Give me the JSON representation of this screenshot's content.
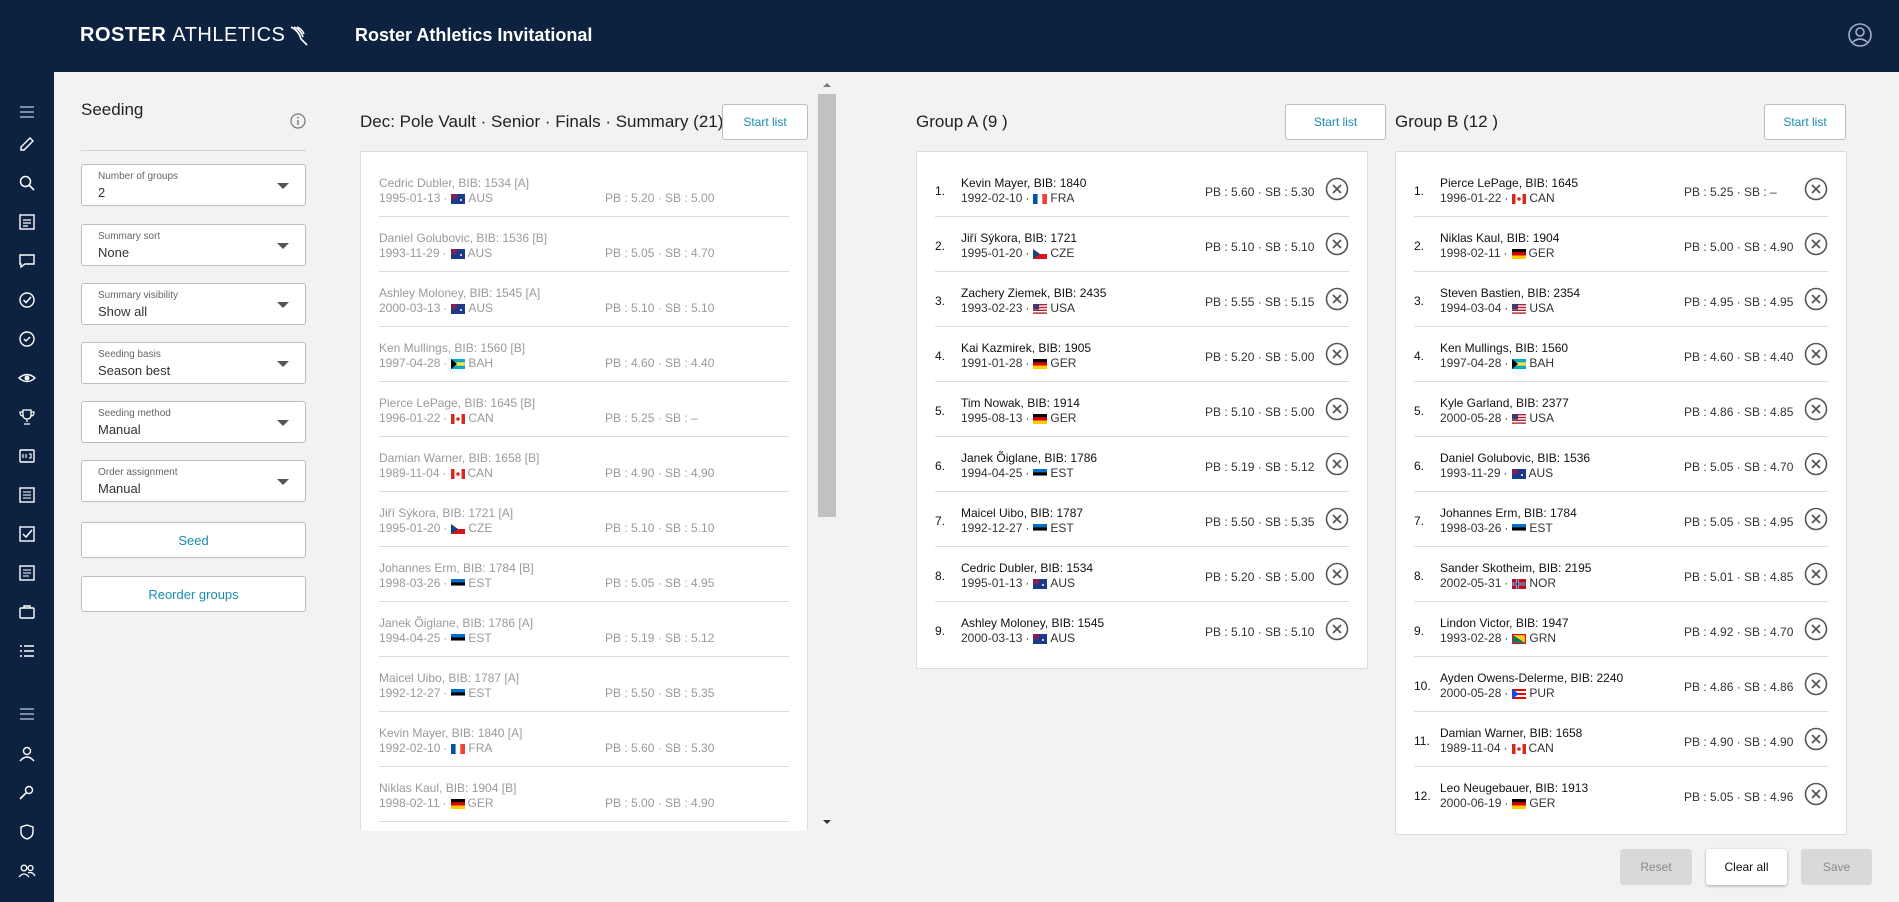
{
  "header": {
    "logo_bold": "ROSTER",
    "logo_light": "ATHLETICS",
    "app_title": "Roster Athletics Invitational"
  },
  "rail_icons": [
    "menu-icon",
    "edit-icon",
    "search-icon",
    "list-icon",
    "chat-icon",
    "check-circle-icon",
    "check-circle-outline-icon",
    "eye-icon",
    "trophy-icon",
    "scoreboard-icon",
    "document-icon",
    "checkbox-icon",
    "notes-icon",
    "briefcase-icon",
    "list-bullets-icon",
    "menu-icon",
    "person-icon",
    "pin-icon",
    "shield-icon",
    "group-icon",
    "table-icon"
  ],
  "seeding": {
    "title": "Seeding",
    "fields": [
      {
        "label": "Number of groups",
        "value": "2"
      },
      {
        "label": "Summary sort",
        "value": "None"
      },
      {
        "label": "Summary visibility",
        "value": "Show all"
      },
      {
        "label": "Seeding basis",
        "value": "Season best"
      },
      {
        "label": "Seeding method",
        "value": "Manual"
      },
      {
        "label": "Order assignment",
        "value": "Manual"
      }
    ],
    "seed_label": "Seed",
    "reorder_label": "Reorder groups"
  },
  "summary": {
    "title": "Dec: Pole Vault · Senior · Finals · Summary (21)",
    "start_list_label": "Start list",
    "rows": [
      {
        "name": "Cedric Dubler, BIB: 1534 [A]",
        "dob": "1995-01-13",
        "country": "AUS",
        "pbsb": "PB : 5.20 · SB : 5.00"
      },
      {
        "name": "Daniel Golubovic, BIB: 1536 [B]",
        "dob": "1993-11-29",
        "country": "AUS",
        "pbsb": "PB : 5.05 · SB : 4.70"
      },
      {
        "name": "Ashley Moloney, BIB: 1545 [A]",
        "dob": "2000-03-13",
        "country": "AUS",
        "pbsb": "PB : 5.10 · SB : 5.10"
      },
      {
        "name": "Ken Mullings, BIB: 1560 [B]",
        "dob": "1997-04-28",
        "country": "BAH",
        "pbsb": "PB : 4.60 · SB : 4.40"
      },
      {
        "name": "Pierce LePage, BIB: 1645 [B]",
        "dob": "1996-01-22",
        "country": "CAN",
        "pbsb": "PB : 5.25 · SB : –"
      },
      {
        "name": "Damian Warner, BIB: 1658 [B]",
        "dob": "1989-11-04",
        "country": "CAN",
        "pbsb": "PB : 4.90 · SB : 4.90"
      },
      {
        "name": "Jiří Sýkora, BIB: 1721 [A]",
        "dob": "1995-01-20",
        "country": "CZE",
        "pbsb": "PB : 5.10 · SB : 5.10"
      },
      {
        "name": "Johannes Erm, BIB: 1784 [B]",
        "dob": "1998-03-26",
        "country": "EST",
        "pbsb": "PB : 5.05 · SB : 4.95"
      },
      {
        "name": "Janek Õiglane, BIB: 1786 [A]",
        "dob": "1994-04-25",
        "country": "EST",
        "pbsb": "PB : 5.19 · SB : 5.12"
      },
      {
        "name": "Maicel Uibo, BIB: 1787 [A]",
        "dob": "1992-12-27",
        "country": "EST",
        "pbsb": "PB : 5.50 · SB : 5.35"
      },
      {
        "name": "Kevin Mayer, BIB: 1840 [A]",
        "dob": "1992-02-10",
        "country": "FRA",
        "pbsb": "PB : 5.60 · SB : 5.30"
      },
      {
        "name": "Niklas Kaul, BIB: 1904 [B]",
        "dob": "1998-02-11",
        "country": "GER",
        "pbsb": "PB : 5.00 · SB : 4.90"
      }
    ]
  },
  "group_a": {
    "title": "Group A (9 )",
    "start_list_label": "Start list",
    "rows": [
      {
        "num": "1.",
        "name": "Kevin Mayer, BIB: 1840",
        "dob": "1992-02-10",
        "country": "FRA",
        "pbsb": "PB : 5.60 · SB : 5.30"
      },
      {
        "num": "2.",
        "name": "Jiří Sýkora, BIB: 1721",
        "dob": "1995-01-20",
        "country": "CZE",
        "pbsb": "PB : 5.10 · SB : 5.10"
      },
      {
        "num": "3.",
        "name": "Zachery Ziemek, BIB: 2435",
        "dob": "1993-02-23",
        "country": "USA",
        "pbsb": "PB : 5.55 · SB : 5.15"
      },
      {
        "num": "4.",
        "name": "Kai Kazmirek, BIB: 1905",
        "dob": "1991-01-28",
        "country": "GER",
        "pbsb": "PB : 5.20 · SB : 5.00"
      },
      {
        "num": "5.",
        "name": "Tim Nowak, BIB: 1914",
        "dob": "1995-08-13",
        "country": "GER",
        "pbsb": "PB : 5.10 · SB : 5.00"
      },
      {
        "num": "6.",
        "name": "Janek Õiglane, BIB: 1786",
        "dob": "1994-04-25",
        "country": "EST",
        "pbsb": "PB : 5.19 · SB : 5.12"
      },
      {
        "num": "7.",
        "name": "Maicel Uibo, BIB: 1787",
        "dob": "1992-12-27",
        "country": "EST",
        "pbsb": "PB : 5.50 · SB : 5.35"
      },
      {
        "num": "8.",
        "name": "Cedric Dubler, BIB: 1534",
        "dob": "1995-01-13",
        "country": "AUS",
        "pbsb": "PB : 5.20 · SB : 5.00"
      },
      {
        "num": "9.",
        "name": "Ashley Moloney, BIB: 1545",
        "dob": "2000-03-13",
        "country": "AUS",
        "pbsb": "PB : 5.10 · SB : 5.10"
      }
    ]
  },
  "group_b": {
    "title": "Group B (12 )",
    "start_list_label": "Start list",
    "rows": [
      {
        "num": "1.",
        "name": "Pierce LePage, BIB: 1645",
        "dob": "1996-01-22",
        "country": "CAN",
        "pbsb": "PB : 5.25 · SB : –"
      },
      {
        "num": "2.",
        "name": "Niklas Kaul, BIB: 1904",
        "dob": "1998-02-11",
        "country": "GER",
        "pbsb": "PB : 5.00 · SB : 4.90"
      },
      {
        "num": "3.",
        "name": "Steven Bastien, BIB: 2354",
        "dob": "1994-03-04",
        "country": "USA",
        "pbsb": "PB : 4.95 · SB : 4.95"
      },
      {
        "num": "4.",
        "name": "Ken Mullings, BIB: 1560",
        "dob": "1997-04-28",
        "country": "BAH",
        "pbsb": "PB : 4.60 · SB : 4.40"
      },
      {
        "num": "5.",
        "name": "Kyle Garland, BIB: 2377",
        "dob": "2000-05-28",
        "country": "USA",
        "pbsb": "PB : 4.86 · SB : 4.85"
      },
      {
        "num": "6.",
        "name": "Daniel Golubovic, BIB: 1536",
        "dob": "1993-11-29",
        "country": "AUS",
        "pbsb": "PB : 5.05 · SB : 4.70"
      },
      {
        "num": "7.",
        "name": "Johannes Erm, BIB: 1784",
        "dob": "1998-03-26",
        "country": "EST",
        "pbsb": "PB : 5.05 · SB : 4.95"
      },
      {
        "num": "8.",
        "name": "Sander Skotheim, BIB: 2195",
        "dob": "2002-05-31",
        "country": "NOR",
        "pbsb": "PB : 5.01 · SB : 4.85"
      },
      {
        "num": "9.",
        "name": "Lindon Victor, BIB: 1947",
        "dob": "1993-02-28",
        "country": "GRN",
        "pbsb": "PB : 4.92 · SB : 4.70"
      },
      {
        "num": "10.",
        "name": "Ayden Owens-Delerme, BIB: 2240",
        "dob": "2000-05-28",
        "country": "PUR",
        "pbsb": "PB : 4.86 · SB : 4.86"
      },
      {
        "num": "11.",
        "name": "Damian Warner, BIB: 1658",
        "dob": "1989-11-04",
        "country": "CAN",
        "pbsb": "PB : 4.90 · SB : 4.90"
      },
      {
        "num": "12.",
        "name": "Leo Neugebauer, BIB: 1913",
        "dob": "2000-06-19",
        "country": "GER",
        "pbsb": "PB : 5.05 · SB : 4.96"
      }
    ]
  },
  "footer": {
    "reset_label": "Reset",
    "clear_label": "Clear all",
    "save_label": "Save"
  },
  "colors": {
    "navy": "#0c2240",
    "accent": "#1a8bb0"
  }
}
